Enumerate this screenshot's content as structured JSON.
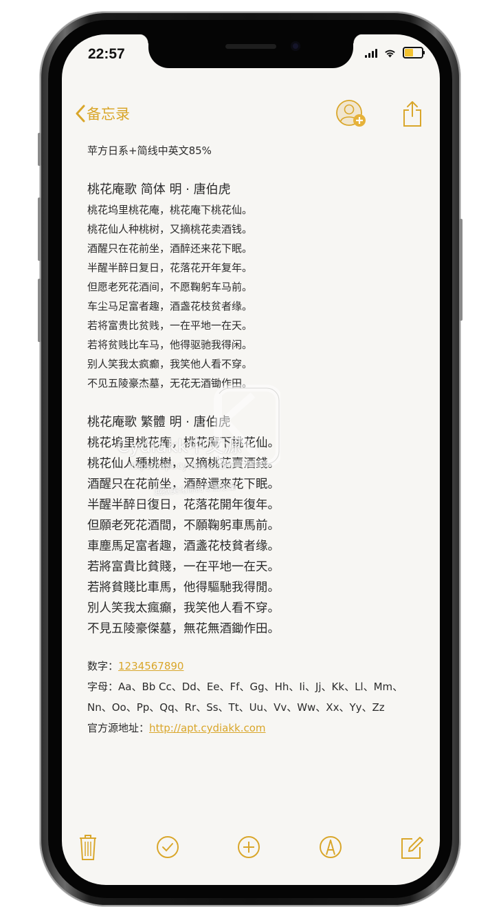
{
  "status_bar": {
    "time": "22:57"
  },
  "nav": {
    "back_label": "备忘录"
  },
  "note": {
    "header": "苹方日系+简线中英文85%",
    "simplified_title": "桃花庵歌  简体   明 · 唐伯虎",
    "simplified_lines": [
      "桃花坞里桃花庵，桃花庵下桃花仙。",
      "桃花仙人种桃树，又摘桃花卖酒钱。",
      "酒醒只在花前坐，酒醉还来花下眠。",
      "半醒半醉日复日，花落花开年复年。",
      "但愿老死花酒间，不愿鞠躬车马前。",
      "车尘马足富者趣，酒盏花枝贫者缘。",
      "若将富贵比贫贱，一在平地一在天。",
      "若将贫贱比车马，他得驱驰我得闲。",
      "别人笑我太疯癫，我笑他人看不穿。",
      "不见五陵豪杰墓，无花无酒锄作田。"
    ],
    "traditional_title": "桃花庵歌  繁體      明 · 唐伯虎",
    "traditional_lines": [
      "桃花塢里桃花庵，桃花庵下桃花仙。",
      "桃花仙人種桃樹，又摘桃花賣酒錢。",
      "酒醒只在花前坐，酒醉還來花下眠。",
      "半醒半醉日復日，花落花開年復年。",
      "但願老死花酒間，不願鞠躬車馬前。",
      "車塵馬足富者趣，酒盞花枝貧者缘。",
      "若將富貴比貧賤，一在平地一在天。",
      "若將貧賤比車馬，他得驅馳我得閒。",
      "別人笑我太瘋癲，我笑他人看不穿。",
      "不見五陵豪傑墓，無花無酒鋤作田。"
    ],
    "digits_label": "数字：",
    "digits_value": "1234567890",
    "letters_line1": "字母：Aa、Bb Cc、Dd、Ee、Ff、Gg、Hh、Ii、Jj、Kk、Ll、Mm、",
    "letters_line2": "Nn、Oo、Pp、Qq、Rr、Ss、Tt、Uu、Vv、Ww、Xx、Yy、Zz",
    "source_label": "官方源地址：",
    "source_url": "http://apt.cydiakk.com"
  },
  "watermark": {
    "title": "Cydiakk中文源",
    "url": "https://apt.cydiakk.com",
    "sub": "越狱美化你的专属设备"
  },
  "colors": {
    "accent": "#d9a62a",
    "paper": "#f7f6f3",
    "text": "#2b2b2b"
  },
  "icons": {
    "nav": [
      "chevron-left-icon",
      "add-person-icon",
      "share-icon"
    ],
    "toolbar": [
      "trash-icon",
      "checklist-icon",
      "add-icon",
      "markup-icon",
      "compose-icon"
    ]
  }
}
